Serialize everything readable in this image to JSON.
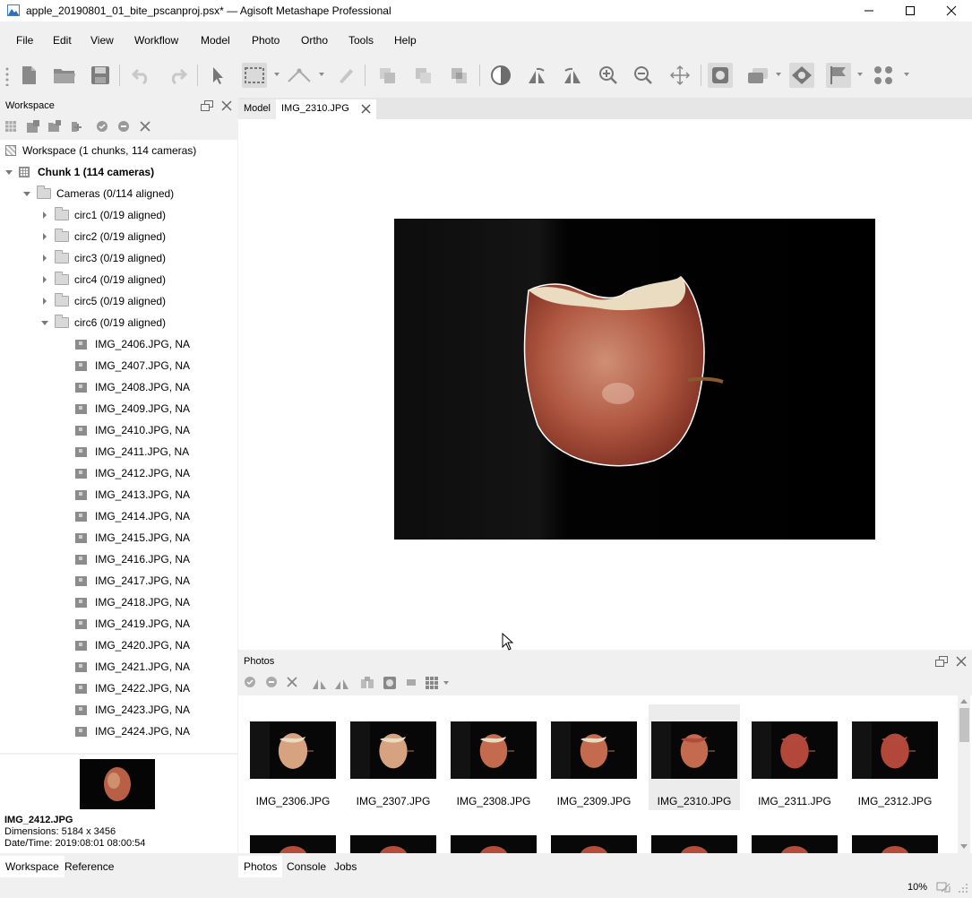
{
  "window": {
    "title": "apple_20190801_01_bite_pscanproj.psx* — Agisoft Metashape Professional"
  },
  "menu": [
    "File",
    "Edit",
    "View",
    "Workflow",
    "Model",
    "Photo",
    "Ortho",
    "Tools",
    "Help"
  ],
  "workspace": {
    "panel_title": "Workspace",
    "root": "Workspace (1 chunks, 114 cameras)",
    "chunk": "Chunk 1 (114 cameras)",
    "cameras": "Cameras (0/114 aligned)",
    "groups": [
      "circ1 (0/19 aligned)",
      "circ2 (0/19 aligned)",
      "circ3 (0/19 aligned)",
      "circ4 (0/19 aligned)",
      "circ5 (0/19 aligned)",
      "circ6 (0/19 aligned)"
    ],
    "images": [
      "IMG_2406.JPG, NA",
      "IMG_2407.JPG, NA",
      "IMG_2408.JPG, NA",
      "IMG_2409.JPG, NA",
      "IMG_2410.JPG, NA",
      "IMG_2411.JPG, NA",
      "IMG_2412.JPG, NA",
      "IMG_2413.JPG, NA",
      "IMG_2414.JPG, NA",
      "IMG_2415.JPG, NA",
      "IMG_2416.JPG, NA",
      "IMG_2417.JPG, NA",
      "IMG_2418.JPG, NA",
      "IMG_2419.JPG, NA",
      "IMG_2420.JPG, NA",
      "IMG_2421.JPG, NA",
      "IMG_2422.JPG, NA",
      "IMG_2423.JPG, NA",
      "IMG_2424.JPG, NA"
    ]
  },
  "preview": {
    "name": "IMG_2412.JPG",
    "dimensions": "Dimensions: 5184 x 3456",
    "datetime": "Date/Time: 2019:08:01 08:00:54"
  },
  "left_tabs": [
    "Workspace",
    "Reference"
  ],
  "doc_tabs": [
    "Model",
    "IMG_2310.JPG"
  ],
  "photos": {
    "panel_title": "Photos",
    "items": [
      "IMG_2306.JPG",
      "IMG_2307.JPG",
      "IMG_2308.JPG",
      "IMG_2309.JPG",
      "IMG_2310.JPG",
      "IMG_2311.JPG",
      "IMG_2312.JPG"
    ],
    "selected": "IMG_2310.JPG"
  },
  "bottom_tabs": [
    "Photos",
    "Console",
    "Jobs"
  ],
  "status": {
    "zoom": "10%"
  }
}
